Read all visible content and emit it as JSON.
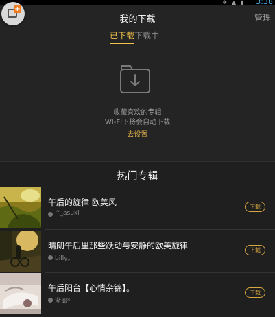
{
  "status_bar": {
    "time": "3:38",
    "icons": "✈ ▲ ▮"
  },
  "header": {
    "title": "我的下载",
    "manage_label": "管理"
  },
  "tabs": [
    {
      "label": "已下载",
      "active": true
    },
    {
      "label": "下载中",
      "active": false
    }
  ],
  "empty_state": {
    "line1": "收藏喜欢的专辑",
    "line2": "WI-FI下将会自动下载",
    "settings_link": "去设置"
  },
  "hot_section": {
    "title": "热门专辑"
  },
  "albums": [
    {
      "name": "午后的旋律  欧美风",
      "author": "^_asuki",
      "download_label": "下载"
    },
    {
      "name": "晴朗午后里那些跃动与安静的欧美旋律",
      "author": "billy。",
      "download_label": "下载"
    },
    {
      "name": "午后阳台【心情杂锦】。",
      "author": "渐离*",
      "download_label": "下载"
    }
  ],
  "colors": {
    "accent": "#f0c04a",
    "background": "#242424",
    "float_button_badge": "#f07a1c",
    "status_time": "#4fb1e8"
  }
}
